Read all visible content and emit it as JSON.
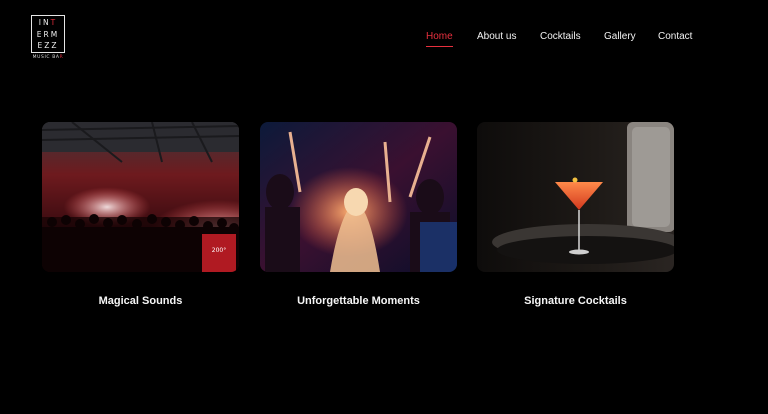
{
  "logo": {
    "rows": [
      "IN",
      "ERM",
      "EZZ"
    ],
    "row1_red": "T",
    "subtitle_main": "MUSIC BA",
    "subtitle_red": "R"
  },
  "nav": {
    "items": [
      {
        "label": "Home",
        "active": true
      },
      {
        "label": "About us",
        "active": false
      },
      {
        "label": "Cocktails",
        "active": false
      },
      {
        "label": "Gallery",
        "active": false
      },
      {
        "label": "Contact",
        "active": false
      }
    ]
  },
  "cards": [
    {
      "title": "Magical Sounds",
      "image": "nightclub-crowd-photo"
    },
    {
      "title": "Unforgettable Moments",
      "image": "party-dancing-photo"
    },
    {
      "title": "Signature Cocktails",
      "image": "cocktail-glass-photo"
    }
  ],
  "colors": {
    "accent": "#e8303e",
    "background": "#000000",
    "text": "#f2f2f2"
  }
}
